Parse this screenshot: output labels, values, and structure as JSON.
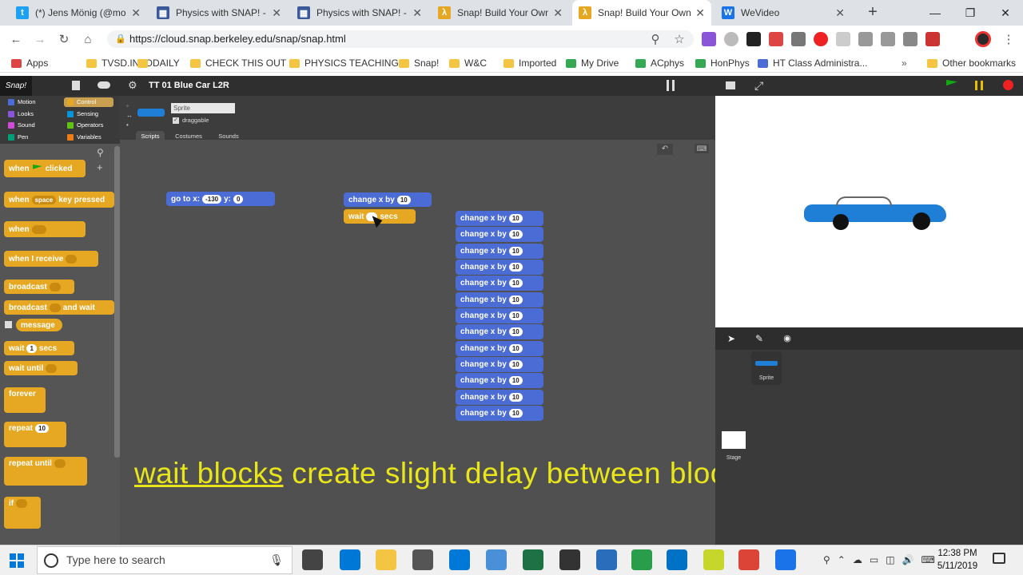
{
  "browser": {
    "tabs": [
      {
        "title": "(*) Jens Mönig (@moen",
        "icon": "twitter-icon",
        "color": "#1da1f2",
        "glyph": "t"
      },
      {
        "title": "Physics with SNAP! - Th",
        "icon": "page-icon",
        "color": "#3b5998",
        "glyph": "▦"
      },
      {
        "title": "Physics with SNAP! - Th",
        "icon": "page-icon",
        "color": "#3b5998",
        "glyph": "▦"
      },
      {
        "title": "Snap! Build Your Own B",
        "icon": "snap-icon",
        "color": "#e6a822",
        "glyph": "λ"
      },
      {
        "title": "Snap! Build Your Own B",
        "icon": "snap-icon",
        "color": "#e6a822",
        "glyph": "λ"
      },
      {
        "title": "WeVideo",
        "icon": "wevideo-icon",
        "color": "#1a73e8",
        "glyph": "W"
      }
    ],
    "url": "https://cloud.snap.berkeley.edu/snap/snap.html",
    "bookmarks": [
      {
        "label": "Apps",
        "color": "#d44"
      },
      {
        "label": "TVSD.INFO",
        "color": "#f4c542"
      },
      {
        "label": "DAILY",
        "color": "#f4c542"
      },
      {
        "label": "CHECK THIS OUT",
        "color": "#f4c542"
      },
      {
        "label": "PHYSICS TEACHING",
        "color": "#f4c542"
      },
      {
        "label": "Snap!",
        "color": "#f4c542"
      },
      {
        "label": "W&C",
        "color": "#f4c542"
      },
      {
        "label": "Imported",
        "color": "#f4c542"
      },
      {
        "label": "My Drive",
        "color": "#34a853"
      },
      {
        "label": "ACphys",
        "color": "#34a853"
      },
      {
        "label": "HonPhys",
        "color": "#34a853"
      },
      {
        "label": "HT Class Administra...",
        "color": "#4a6cd4"
      }
    ],
    "other_bookmarks": "Other bookmarks"
  },
  "snap": {
    "project_name": "TT 01 Blue Car L2R",
    "categories": [
      {
        "label": "Motion",
        "color": "#4a6cd4"
      },
      {
        "label": "Control",
        "color": "#e6a822",
        "selected": true
      },
      {
        "label": "Looks",
        "color": "#8a55d7"
      },
      {
        "label": "Sensing",
        "color": "#0494dc"
      },
      {
        "label": "Sound",
        "color": "#cf4ad9"
      },
      {
        "label": "Operators",
        "color": "#62c213"
      },
      {
        "label": "Pen",
        "color": "#00a178"
      },
      {
        "label": "Variables",
        "color": "#ee7d16"
      }
    ],
    "sprite_name": "Sprite",
    "draggable_label": "draggable",
    "tabs": [
      "Scripts",
      "Costumes",
      "Sounds"
    ],
    "palette": {
      "when_clicked": "when",
      "when_clicked_end": "clicked",
      "when_key": "when",
      "key_value": "space",
      "key_pressed": "key pressed",
      "when_generic": "when",
      "when_receive": "when I receive",
      "broadcast": "broadcast",
      "broadcast_wait_a": "broadcast",
      "broadcast_wait_b": "and wait",
      "message": "message",
      "wait": "wait",
      "wait_value": "1",
      "wait_secs": "secs",
      "wait_until": "wait until",
      "forever": "forever",
      "repeat": "repeat",
      "repeat_value": "10",
      "repeat_until": "repeat until",
      "if": "if"
    },
    "script_blocks": {
      "goto_label": "go to x:",
      "goto_x": "-130",
      "goto_y_label": "y:",
      "goto_y": "0",
      "change_label": "change x by",
      "change_value": "10",
      "wait_label": "wait",
      "wait_secs": "secs",
      "stack_count": 13
    },
    "corral_sprite": "Sprite",
    "stage_label": "Stage"
  },
  "caption": {
    "underlined": "wait blocks",
    "rest": " create slight delay between blocks"
  },
  "taskbar": {
    "search_placeholder": "Type here to search",
    "time": "12:38 PM",
    "date": "5/11/2019"
  }
}
